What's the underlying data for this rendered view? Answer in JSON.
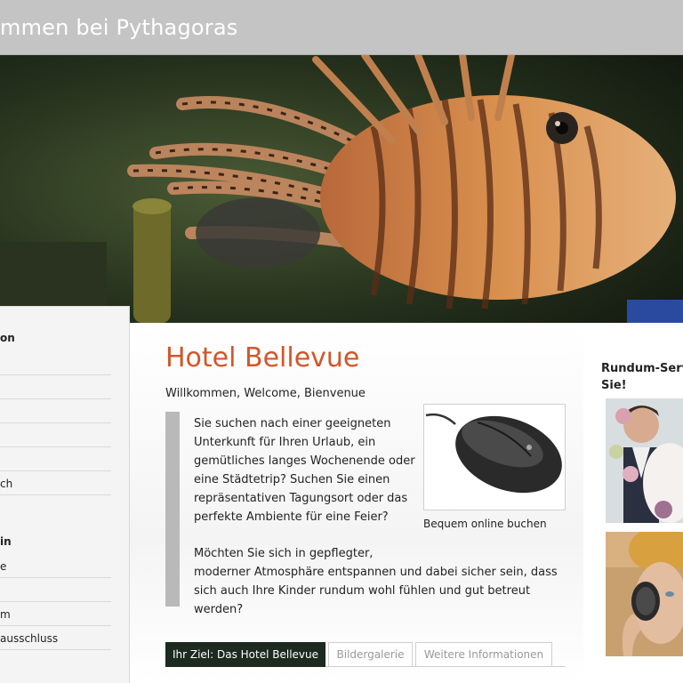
{
  "header": {
    "title": "mmen bei Pythagoras"
  },
  "hero": {
    "image": "lionfish-aquarium-photo"
  },
  "sidebar": {
    "headings": [
      "on",
      "in"
    ],
    "items": [
      "",
      "",
      "",
      "",
      "",
      "ch",
      "e",
      "",
      "m",
      "ausschluss"
    ]
  },
  "main": {
    "title": "Hotel Bellevue",
    "welcome": "Willkommen, Welcome, Bienvenue",
    "paragraph1": "Sie suchen nach einer geeigneten Unterkunft für Ihren Urlaub, ein gemütliches langes Wochenende oder eine Städtetrip? Suchen Sie einen repräsentativen Tagungsort oder das perfekte Ambiente für eine Feier?",
    "paragraph2_line1": "Möchten Sie sich in gepflegter,",
    "paragraph2_line2": "moderner Atmosphäre entspannen und dabei sicher sein, dass sich auch Ihre Kinder rundum wohl fühlen und gut betreut werden?",
    "promo": {
      "image": "computer-mouse-photo",
      "caption": "Bequem online buchen"
    },
    "tabs": [
      {
        "label": "Ihr Ziel: Das Hotel Bellevue",
        "active": true
      },
      {
        "label": "Bildergalerie",
        "active": false
      },
      {
        "label": "Weitere Informationen",
        "active": false
      }
    ]
  },
  "right": {
    "heading_line1": "Rundum-Servic",
    "heading_line2": "Sie!",
    "images": [
      "wedding-couple-photo",
      "woman-mirror-photo"
    ]
  },
  "colors": {
    "accent": "#d2562a",
    "header_bg": "#c4c4c4",
    "active_tab": "#1c2a1f"
  }
}
